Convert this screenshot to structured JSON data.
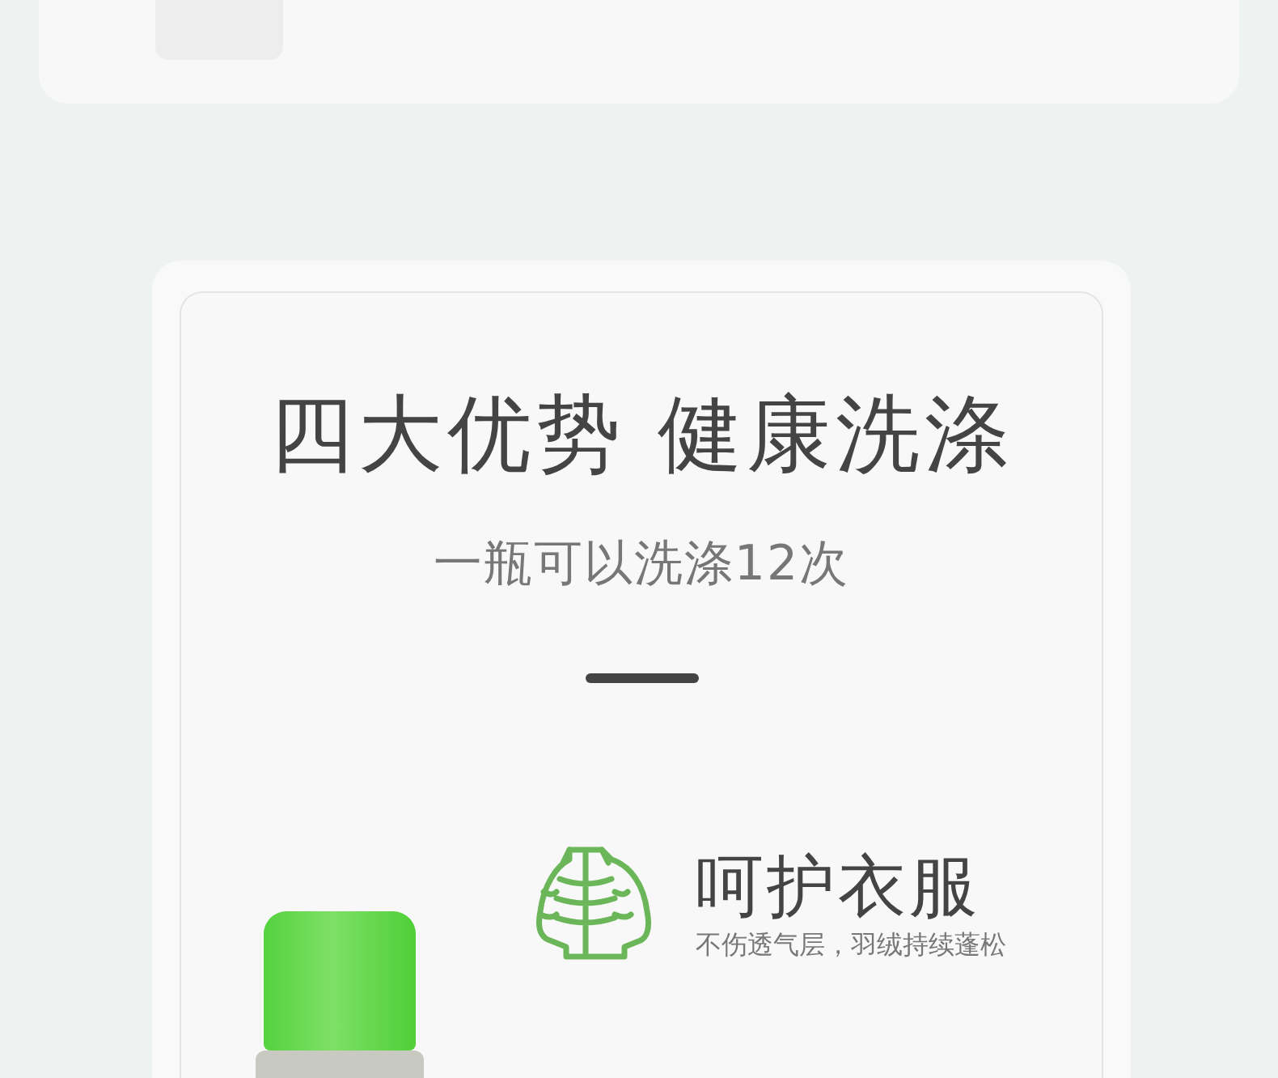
{
  "heading": "四大优势 健康洗涤",
  "subheading": "一瓶可以洗涤12次",
  "features": [
    {
      "title": "呵护衣服",
      "description": "不伤透气层，羽绒持续蓬松"
    }
  ]
}
